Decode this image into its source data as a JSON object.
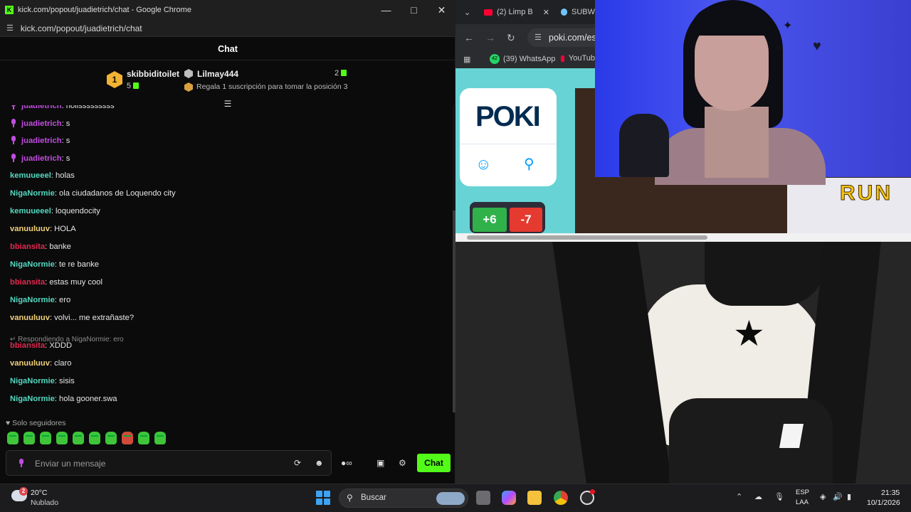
{
  "chat_window": {
    "title": "kick.com/popout/juadietrich/chat - Google Chrome",
    "url": "kick.com/popout/juadietrich/chat",
    "header": "Chat",
    "leaderboard": {
      "first": {
        "rank": "1",
        "name": "skibbiditoilet",
        "count": "5"
      },
      "second": {
        "name": "Lilmay444",
        "count": "2"
      },
      "third_hint": "Regala 1 suscripción para tomar la posición 3"
    },
    "messages": [
      {
        "user": "juadietrich",
        "text": ": holisssssssss",
        "color": "#c24de0",
        "mic": true
      },
      {
        "user": "juadietrich",
        "text": ": s",
        "color": "#c24de0",
        "mic": true
      },
      {
        "user": "juadietrich",
        "text": ": s",
        "color": "#c24de0",
        "mic": true
      },
      {
        "user": "juadietrich",
        "text": ": s",
        "color": "#c24de0",
        "mic": true
      },
      {
        "user": "kemuueeel",
        "text": ": holas",
        "color": "#53d9c0"
      },
      {
        "user": "NigaNormie",
        "text": ": ola ciudadanos de Loquendo city",
        "color": "#53d9c0"
      },
      {
        "user": "kemuueeel",
        "text": ": loquendocity",
        "color": "#53d9c0"
      },
      {
        "user": "vanuuluuv",
        "text": ": HOLA",
        "color": "#f2d27a"
      },
      {
        "user": "bbiansita",
        "text": ": banke",
        "color": "#e2294f"
      },
      {
        "user": "NigaNormie",
        "text": ": te re banke",
        "color": "#53d9c0"
      },
      {
        "user": "bbiansita",
        "text": ": estas muy cool",
        "color": "#e2294f"
      },
      {
        "user": "NigaNormie",
        "text": ": ero",
        "color": "#53d9c0"
      },
      {
        "user": "vanuuluuv",
        "text": ": volvi... me extrañaste?",
        "color": "#f2d27a"
      },
      {
        "user": "bbiansita",
        "text": ": XDDD",
        "color": "#e2294f"
      },
      {
        "user": "vanuuluuv",
        "text": ": claro",
        "color": "#f2d27a"
      },
      {
        "user": "NigaNormie",
        "text": ": sisis",
        "color": "#53d9c0"
      },
      {
        "user": "NigaNormie",
        "text": ": hola gooner.swa",
        "color": "#53d9c0"
      }
    ],
    "reply_hint": "Respondiendo a NigaNormie: ero",
    "followers_only": "Solo seguidores",
    "input_placeholder": "Enviar un mensaje",
    "chat_button": "Chat"
  },
  "browser": {
    "tabs": [
      {
        "label": "(2) Limp B"
      },
      {
        "label": "SUBW"
      }
    ],
    "url": "poki.com/es/",
    "bookmarks": [
      {
        "badge": "42",
        "label": "(39) WhatsApp"
      },
      {
        "label": "YouTub"
      }
    ],
    "poki_logo": "POKI",
    "game_tiles": [
      "+6",
      "-7"
    ],
    "banner_text": "RUN"
  },
  "taskbar": {
    "weather_badge": "2",
    "temperature": "20°C",
    "condition": "Nublado",
    "search_label": "Buscar",
    "lang_line1": "ESP",
    "lang_line2": "LAA",
    "time": "21:35",
    "date": "10/1/2026"
  },
  "colors": {
    "kick_green": "#53fc18",
    "chrome_dark": "#202124"
  }
}
